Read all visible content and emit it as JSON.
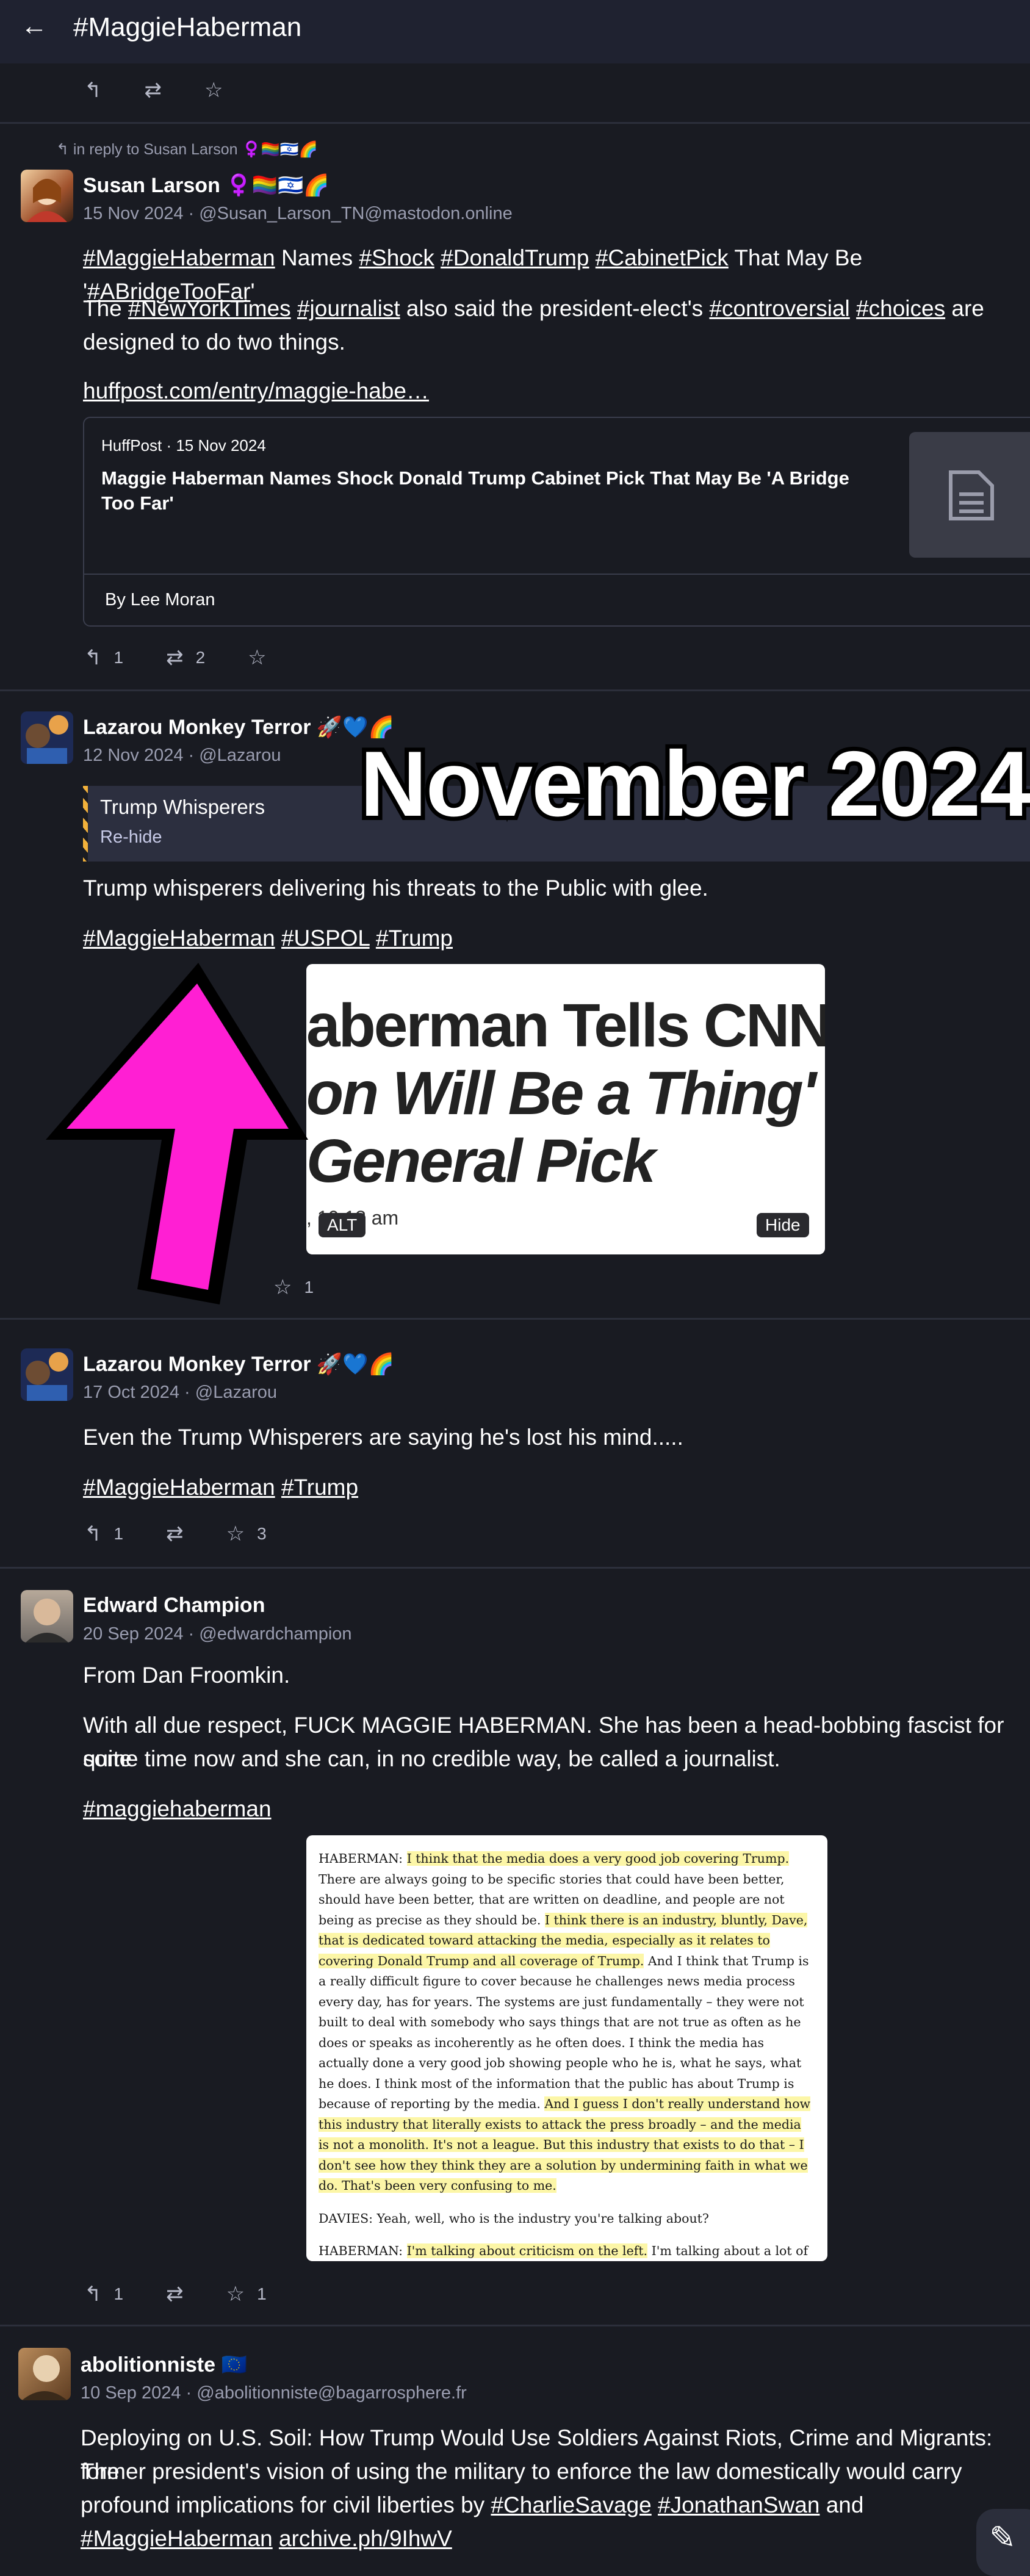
{
  "header": {
    "back_icon": "←",
    "title": "#MaggieHaberman"
  },
  "overlay_title": "November 2024",
  "post0": {
    "actions": {
      "reply_icon": "↰",
      "boost_icon": "⇄",
      "fav_icon": "☆"
    }
  },
  "post1": {
    "reply_to": "in reply to Susan Larson ♀️🏳️‍🌈🇮🇱🌈",
    "name": "Susan Larson ♀️🏳️‍🌈🇮🇱🌈",
    "meta": "15 Nov 2024 · @Susan_Larson_TN@mastodon.online",
    "line1": [
      "#MaggieHaberman",
      " Names ",
      "#Shock",
      " ",
      "#DonaldTrump",
      " ",
      "#CabinetPick",
      " That May Be '",
      "#ABridgeTooFar",
      "'"
    ],
    "line2a": [
      "The ",
      "#NewYorkTimes",
      " ",
      "#journalist",
      " also said the president-elect's ",
      "#controversial",
      " ",
      "#choices",
      " are"
    ],
    "line2b": "designed to do two things.",
    "link": "huffpost.com/entry/maggie-habe…",
    "card": {
      "source": "HuffPost · 15 Nov 2024",
      "title": "Maggie Haberman Names Shock Donald Trump Cabinet Pick That May Be 'A Bridge Too Far'",
      "byline": "By Lee Moran"
    },
    "actions": {
      "reply_count": "1",
      "boost_count": "2"
    }
  },
  "post2": {
    "name": "Lazarou Monkey Terror 🚀💙🌈",
    "meta": "12 Nov 2024 · @Lazarou",
    "cw_title": "Trump Whisperers",
    "cw_button": "Re-hide",
    "text": "Trump whisperers delivering his threats to the Public with glee.",
    "tags": [
      "#MaggieHaberman",
      "#USPOL",
      "#Trump"
    ],
    "image_lines": [
      "aberman Tells CNN",
      "on Will Be a Thing' i",
      "General Pick"
    ],
    "image_time": ", 10:18 am",
    "alt_label": "ALT",
    "hide_label": "Hide",
    "actions": {
      "fav_count": "1"
    }
  },
  "post3": {
    "name": "Lazarou Monkey Terror 🚀💙🌈",
    "meta": "17 Oct 2024 · @Lazarou",
    "text": "Even the Trump Whisperers are saying he's lost his mind.....",
    "tags": [
      "#MaggieHaberman",
      "#Trump"
    ],
    "actions": {
      "reply_count": "1",
      "fav_count": "3"
    }
  },
  "post4": {
    "name": "Edward Champion",
    "meta": "20 Sep 2024 · @edwardchampion",
    "p1": "From Dan Froomkin.",
    "p2a": "With all due respect, FUCK MAGGIE HABERMAN. She has been a head-bobbing fascist for quite",
    "p2b": "some time now and she can, in no credible way, be called a journalist.",
    "tag": "#maggiehaberman",
    "doc": {
      "p1": [
        {
          "t": "HABERMAN: ",
          "h": false
        },
        {
          "t": "I think that the media does a very good job covering Trump.",
          "h": true
        },
        {
          "t": " There are always going to be specific stories that could have been better, should have been better, that are written on deadline, and people are not being as precise as they should be. ",
          "h": false
        },
        {
          "t": "I think there is an industry, bluntly, Dave, that is dedicated toward attacking the media, especially as it relates to covering Donald Trump and all coverage of Trump.",
          "h": true
        },
        {
          "t": " And I think that Trump is a really difficult figure to cover because he challenges news media process every day, has for years. The systems are just fundamentally – they were not built to deal with somebody who says things that are not true as often as he does or speaks as incoherently as he often does. I think the media has actually done a very good job showing people who he is, what he says, what he does. I think most of the information that the public has about Trump is because of reporting by the media. ",
          "h": false
        },
        {
          "t": "And I guess I don't really understand how this industry that literally exists to attack the press broadly – and the media is not a monolith. It's not a league. But this industry that exists to do that – I don't see how they think they are a solution by undermining faith in what we do. That's been very confusing to me.",
          "h": true
        }
      ],
      "p2": "DAVIES: Yeah, well, who is the industry you're talking about?",
      "p3": [
        {
          "t": "HABERMAN: ",
          "h": false
        },
        {
          "t": "I'm talking about criticism on the left.",
          "h": true
        },
        {
          "t": " I'm talking about a lot of",
          "h": false
        }
      ]
    },
    "actions": {
      "reply_count": "1",
      "fav_count": "1"
    }
  },
  "post5": {
    "name": "abolitionniste 🇪🇺",
    "meta": "10 Sep 2024 · @abolitionniste@bagarrosphere.fr",
    "line1": "Deploying on U.S. Soil: How Trump Would Use Soldiers Against Riots, Crime and Migrants: The",
    "line2": "former president's vision of using the military to enforce the law domestically would carry",
    "line3a": [
      "profound implications for civil liberties by ",
      "#CharlieSavage",
      " ",
      "#JonathanSwan",
      " and"
    ],
    "line4": [
      "#MaggieHaberman",
      " ",
      "archive.ph/9IhwV"
    ]
  },
  "fab_icon": "✎",
  "colors": {
    "background": "#191b22",
    "header": "#1f2230",
    "arrow": "#ff1fd3",
    "highlight": "#fcf6a7"
  }
}
